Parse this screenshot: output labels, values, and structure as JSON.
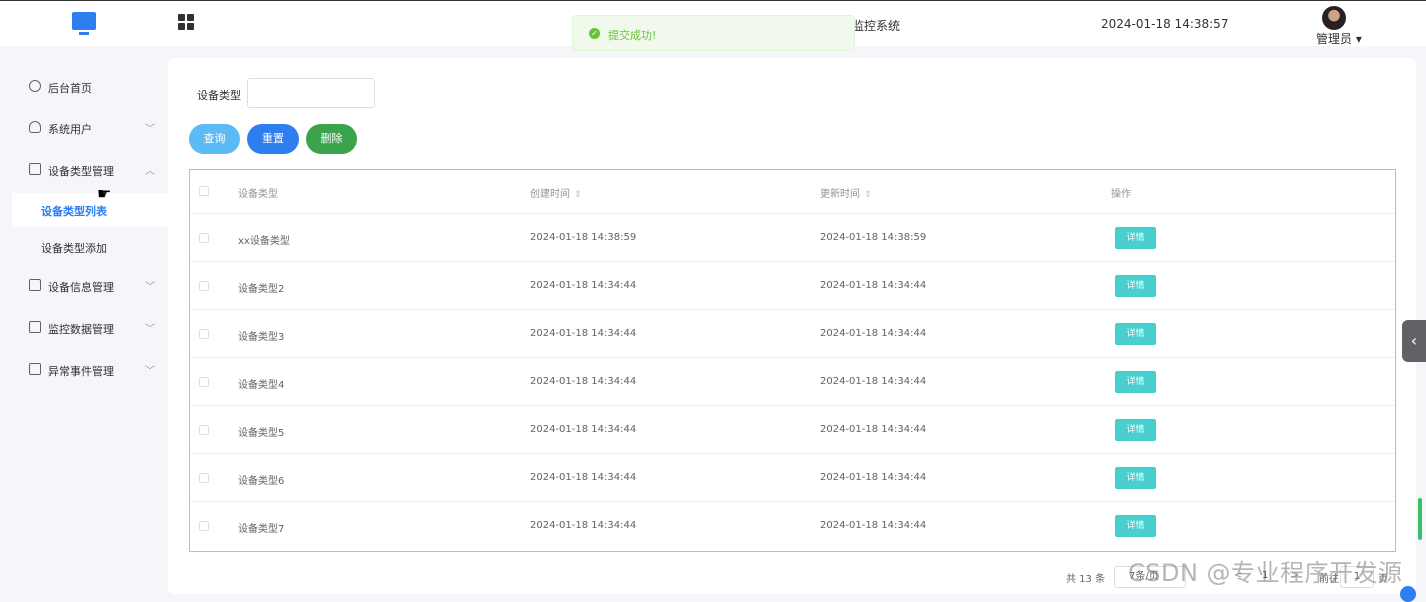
{
  "header": {
    "title": "监控系统",
    "datetime": "2024-01-18 14:38:57",
    "user": "管理员 ▾"
  },
  "toast": {
    "message": "提交成功!"
  },
  "sidebar": {
    "items": [
      {
        "label": "后台首页",
        "icon": "clock-icon"
      },
      {
        "label": "系统用户",
        "icon": "user-icon",
        "arrow": "﹀"
      },
      {
        "label": "设备类型管理",
        "icon": "monitor-icon",
        "arrow": "︿"
      },
      {
        "label": "设备信息管理",
        "icon": "monitor-icon",
        "arrow": "﹀"
      },
      {
        "label": "监控数据管理",
        "icon": "monitor-icon",
        "arrow": "﹀"
      },
      {
        "label": "异常事件管理",
        "icon": "monitor-icon",
        "arrow": "﹀"
      }
    ],
    "subitems": [
      {
        "label": "设备类型列表",
        "active": true
      },
      {
        "label": "设备类型添加",
        "active": false
      }
    ]
  },
  "filter": {
    "label": "设备类型",
    "value": ""
  },
  "buttons": {
    "query": "查询",
    "reset": "重置",
    "delete": "删除"
  },
  "table": {
    "headers": {
      "name": "设备类型",
      "created": "创建时间",
      "updated": "更新时间",
      "actions": "操作"
    },
    "sort_icon": "⇕",
    "rows": [
      {
        "name": "xx设备类型",
        "created": "2024-01-18 14:38:59",
        "updated": "2024-01-18 14:38:59",
        "action": "详情"
      },
      {
        "name": "设备类型2",
        "created": "2024-01-18 14:34:44",
        "updated": "2024-01-18 14:34:44",
        "action": "详情"
      },
      {
        "name": "设备类型3",
        "created": "2024-01-18 14:34:44",
        "updated": "2024-01-18 14:34:44",
        "action": "详情"
      },
      {
        "name": "设备类型4",
        "created": "2024-01-18 14:34:44",
        "updated": "2024-01-18 14:34:44",
        "action": "详情"
      },
      {
        "name": "设备类型5",
        "created": "2024-01-18 14:34:44",
        "updated": "2024-01-18 14:34:44",
        "action": "详情"
      },
      {
        "name": "设备类型6",
        "created": "2024-01-18 14:34:44",
        "updated": "2024-01-18 14:34:44",
        "action": "详情"
      },
      {
        "name": "设备类型7",
        "created": "2024-01-18 14:34:44",
        "updated": "2024-01-18 14:34:44",
        "action": "详情"
      }
    ]
  },
  "pagination": {
    "total": "共 13 条",
    "page_size": "7条/页",
    "prev": "<",
    "current": "1",
    "next": ">",
    "goto_prefix": "前往",
    "goto_value": "1",
    "goto_suffix": "页"
  },
  "watermark": "CSDN @专业程序开发源",
  "collapse_icon": "‹",
  "colors": {
    "primary": "#2e7ef0",
    "query": "#5bbcf5",
    "delete": "#3ca34d",
    "detail": "#47cfd0",
    "success": "#67c23a"
  }
}
